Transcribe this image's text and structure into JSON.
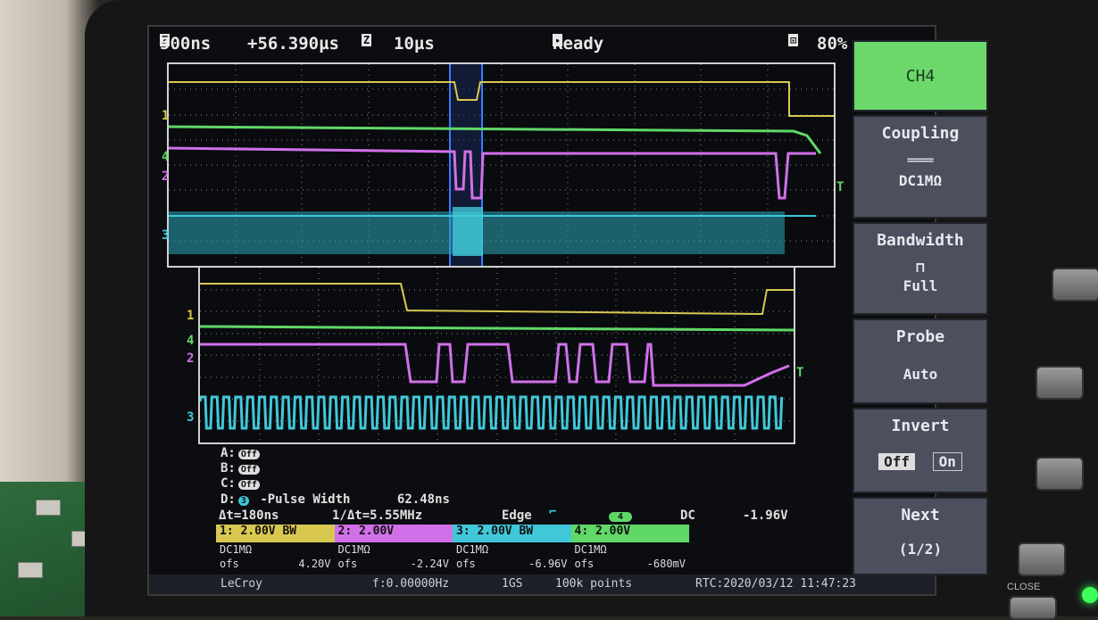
{
  "topbar": {
    "timebase": "500ns",
    "delay": "+56.390µs",
    "zoom_timebase": "10µs",
    "acq_status": "Ready",
    "zoom_percent": "80%"
  },
  "channel_markers": {
    "ch1": "1",
    "ch2": "2",
    "ch3": "3",
    "ch4": "4",
    "trigger": "T"
  },
  "measurements": {
    "a_label": "A:",
    "a_state": "Off",
    "b_label": "B:",
    "b_state": "Off",
    "c_label": "C:",
    "c_state": "Off",
    "d_label": "D:",
    "d_source": "3",
    "d_param": "-Pulse Width",
    "d_value": "62.48ns",
    "delta_t": "Δt=180ns",
    "inv_delta_t": "1/Δt=5.55MHz",
    "trigger_type": "Edge",
    "trigger_source": "4",
    "trigger_coupling": "DC",
    "trigger_level": "-1.96V"
  },
  "channels": [
    {
      "label": "1: 2.00V",
      "bw": "BW",
      "coupling": "DC1MΩ",
      "ofs_label": "ofs",
      "offset": "4.20V",
      "color": "#d8c850"
    },
    {
      "label": "2: 2.00V",
      "bw": "",
      "coupling": "DC1MΩ",
      "ofs_label": "ofs",
      "offset": "-2.24V",
      "color": "#d070e8"
    },
    {
      "label": "3: 2.00V",
      "bw": "BW",
      "coupling": "DC1MΩ",
      "ofs_label": "ofs",
      "offset": "-6.96V",
      "color": "#40c8d8"
    },
    {
      "label": "4: 2.00V",
      "bw": "",
      "coupling": "DC1MΩ",
      "ofs_label": "ofs",
      "offset": "-680mV",
      "color": "#60d868"
    }
  ],
  "status": {
    "brand": "LeCroy",
    "frequency": "f:0.00000Hz",
    "sample_rate": "1GS",
    "points": "100k points",
    "rtc": "RTC:2020/03/12 11:47:23"
  },
  "softkeys": {
    "channel": "CH4",
    "coupling_title": "Coupling",
    "coupling_value": "DC1MΩ",
    "bandwidth_title": "Bandwidth",
    "bandwidth_value": "Full",
    "probe_title": "Probe",
    "probe_value": "Auto",
    "invert_title": "Invert",
    "invert_off": "Off",
    "invert_on": "On",
    "next_title": "Next",
    "next_page": "(1/2)"
  },
  "hardware": {
    "close_label": "CLOSE"
  }
}
